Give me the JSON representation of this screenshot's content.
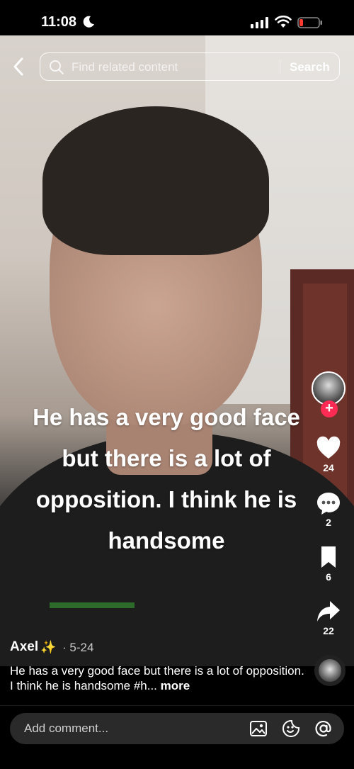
{
  "status_bar": {
    "time": "11:08"
  },
  "search": {
    "placeholder": "Find related content",
    "button_label": "Search"
  },
  "video": {
    "caption_lines": [
      "He has a very good face",
      "but there is a lot of",
      "opposition. I think he is",
      "handsome"
    ]
  },
  "actions": {
    "likes": "24",
    "comments": "2",
    "saves": "6",
    "shares": "22"
  },
  "post": {
    "author": "Axel",
    "author_emoji": "✨",
    "date": "· 5-24",
    "description": "He has a very good face but there is a lot of opposition. I think he is handsome #h...",
    "more_label": "more"
  },
  "comment_bar": {
    "placeholder": "Add comment..."
  },
  "colors": {
    "accent": "#fe2c55",
    "background": "#000000"
  }
}
